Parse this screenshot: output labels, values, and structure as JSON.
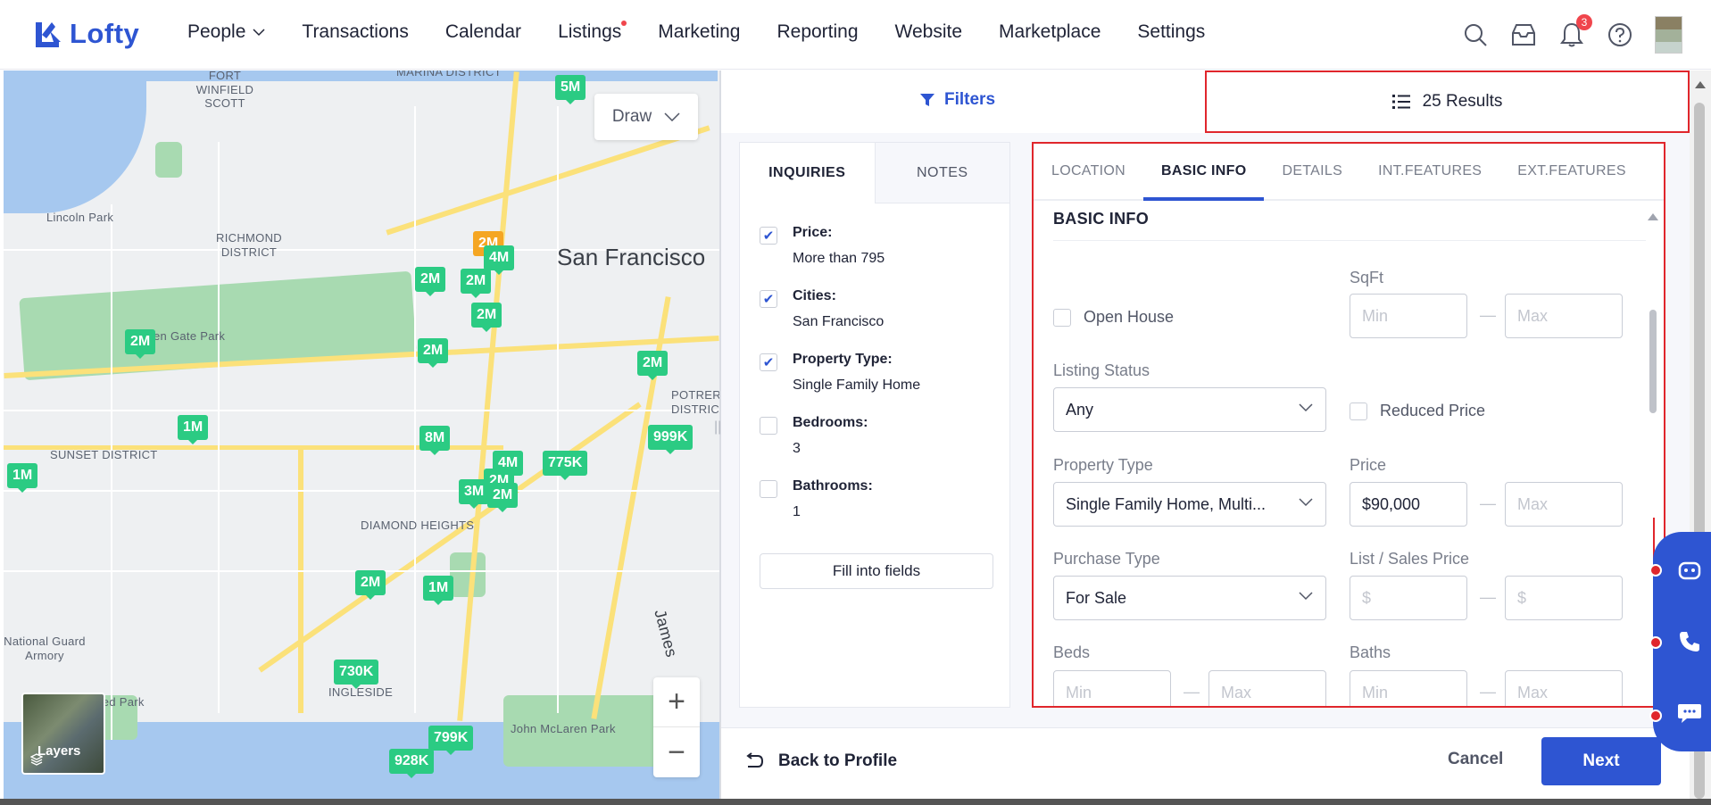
{
  "brand": {
    "name": "Lofty",
    "color": "#2e55d2"
  },
  "nav": {
    "items": [
      {
        "label": "People",
        "has_dropdown": true
      },
      {
        "label": "Transactions"
      },
      {
        "label": "Calendar"
      },
      {
        "label": "Listings",
        "has_dot": true
      },
      {
        "label": "Marketing"
      },
      {
        "label": "Reporting"
      },
      {
        "label": "Website"
      },
      {
        "label": "Marketplace"
      },
      {
        "label": "Settings"
      }
    ],
    "icons": [
      "search-icon",
      "inbox-icon",
      "bell-icon",
      "help-icon"
    ],
    "notification_count": "3"
  },
  "map": {
    "draw_label": "Draw",
    "layers_label": "Layers",
    "city_label": "San Francisco",
    "labels": [
      "FORT WINFIELD SCOTT",
      "MARINA DISTRICT",
      "Lincoln Park",
      "RICHMOND DISTRICT",
      "en Gate Park",
      "SUNSET DISTRICT",
      "DIAMOND HEIGHTS",
      "INGLESIDE",
      "POTRERO DISTRIC",
      "National Guard Armory",
      "John McLaren Park",
      "ced Park",
      "James"
    ],
    "pins": [
      "5M",
      "2M",
      "4M",
      "2M",
      "2M",
      "2M",
      "2M",
      "2M",
      "2M",
      "1M",
      "1M",
      "8M",
      "999K",
      "4M",
      "775K",
      "2M",
      "3M",
      "2M",
      "2M",
      "1M",
      "730K",
      "799K",
      "928K"
    ]
  },
  "filters": {
    "label": "Filters"
  },
  "results": {
    "label": "25 Results"
  },
  "inquiries": {
    "tabs": [
      "INQUIRIES",
      "NOTES"
    ],
    "items": [
      {
        "label": "Price:",
        "value": "More than 795",
        "checked": true
      },
      {
        "label": "Cities:",
        "value": "San Francisco",
        "checked": true
      },
      {
        "label": "Property Type:",
        "value": "Single Family Home",
        "checked": true
      },
      {
        "label": "Bedrooms:",
        "value": "3",
        "checked": false
      },
      {
        "label": "Bathrooms:",
        "value": "1",
        "checked": false
      }
    ],
    "fill_button": "Fill into fields"
  },
  "form": {
    "tabs": [
      "LOCATION",
      "BASIC INFO",
      "DETAILS",
      "INT.FEATURES",
      "EXT.FEATURES"
    ],
    "active_tab": "BASIC INFO",
    "section_title": "BASIC INFO",
    "open_house": "Open House",
    "sqft": {
      "label": "SqFt",
      "min_placeholder": "Min",
      "max_placeholder": "Max"
    },
    "listing_status": {
      "label": "Listing Status",
      "value": "Any"
    },
    "reduced_price": "Reduced Price",
    "property_type": {
      "label": "Property Type",
      "value": "Single Family Home, Multi..."
    },
    "price": {
      "label": "Price",
      "min_value": "$90,000",
      "max_placeholder": "Max"
    },
    "purchase_type": {
      "label": "Purchase Type",
      "value": "For Sale"
    },
    "list_sales_price": {
      "label": "List / Sales Price",
      "min_placeholder": "$",
      "max_placeholder": "$"
    },
    "beds": {
      "label": "Beds",
      "min_placeholder": "Min",
      "max_placeholder": "Max"
    },
    "baths": {
      "label": "Baths",
      "min_placeholder": "Min",
      "max_placeholder": "Max"
    },
    "range_sep": "—"
  },
  "bottom": {
    "back": "Back to Profile",
    "cancel": "Cancel",
    "next": "Next"
  },
  "colors": {
    "accent": "#2e55d2",
    "pin": "#2bcb83",
    "pin_highlight": "#f5a623",
    "highlight_frame": "#e0262c"
  }
}
